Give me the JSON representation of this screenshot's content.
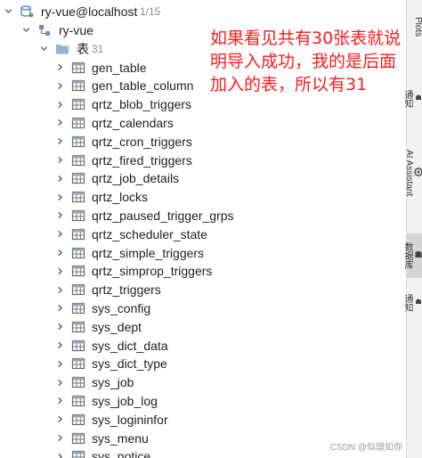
{
  "tree": {
    "connection": {
      "name": "ry-vue@localhost",
      "count": "1/15"
    },
    "schema": {
      "name": "ry-vue"
    },
    "tables_folder": {
      "name": "表",
      "count": "31"
    },
    "tables": [
      "gen_table",
      "gen_table_column",
      "qrtz_blob_triggers",
      "qrtz_calendars",
      "qrtz_cron_triggers",
      "qrtz_fired_triggers",
      "qrtz_job_details",
      "qrtz_locks",
      "qrtz_paused_trigger_grps",
      "qrtz_scheduler_state",
      "qrtz_simple_triggers",
      "qrtz_simprop_triggers",
      "qrtz_triggers",
      "sys_config",
      "sys_dept",
      "sys_dict_data",
      "sys_dict_type",
      "sys_job",
      "sys_job_log",
      "sys_logininfor",
      "sys_menu",
      "sys_notice"
    ]
  },
  "annotation": {
    "text": "如果看见共有30张表就说明导入成功，我的是后面加入的表，所以有31"
  },
  "sidebar": {
    "tabs": [
      {
        "label": "Plots"
      },
      {
        "label": "通知"
      },
      {
        "label": "AI Assistant"
      },
      {
        "label": "数据库"
      },
      {
        "label": "通知"
      }
    ]
  },
  "watermark": "CSDN @似璟如你",
  "icons": {
    "connection": "db-connection-icon",
    "schema": "schema-icon",
    "folder": "folder-icon",
    "table": "table-icon",
    "chevron": "chevron-icon"
  },
  "colors": {
    "annotation": "#ff1a1a",
    "folder": "#8fb3d9",
    "table_icon": "#6b6b6b",
    "active_tab": "#d5d5d5"
  }
}
